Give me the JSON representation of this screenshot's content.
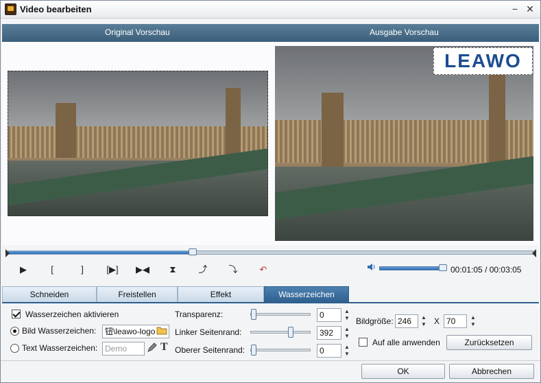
{
  "window": {
    "title": "Video bearbeiten",
    "minimize": "−",
    "close": "✕"
  },
  "preview": {
    "original_label": "Original Vorschau",
    "output_label": "Ausgabe Vorschau",
    "watermark_logo_text": "LEAWO"
  },
  "playback": {
    "progress_fraction": 0.35,
    "time_current": "00:01:05",
    "time_separator": "/",
    "time_total": "00:03:05",
    "volume_fraction": 1.0
  },
  "controls": {
    "play": "▶",
    "mark_in": "[",
    "mark_out": "]",
    "frame_step": "[▶]",
    "skip": "▶◀",
    "flip_vertical": "⧗",
    "rotate_right": "⤴",
    "rotate_left": "⤵",
    "undo": "↶"
  },
  "tabs": [
    {
      "label": "Schneiden",
      "active": false
    },
    {
      "label": "Freistellen",
      "active": false
    },
    {
      "label": "Effekt",
      "active": false
    },
    {
      "label": "Wasserzeichen",
      "active": true
    }
  ],
  "watermark": {
    "enable_label": "Wasserzeichen aktivieren",
    "enable_checked": true,
    "image_label": "Bild Wasserzeichen:",
    "image_selected": true,
    "image_path": "钮\\leawo-logo",
    "text_label": "Text Wasserzeichen:",
    "text_placeholder": "Demo",
    "transparency_label": "Transparenz:",
    "transparency_value": "0",
    "left_margin_label": "Linker Seitenrand:",
    "left_margin_value": "392",
    "top_margin_label": "Oberer Seitenrand:",
    "top_margin_value": "0",
    "size_label": "Bildgröße:",
    "width_value": "246",
    "size_x": "X",
    "height_value": "70",
    "apply_all_label": "Auf alle anwenden",
    "apply_all_checked": false,
    "reset_label": "Zurücksetzen"
  },
  "footer": {
    "ok_label": "OK",
    "cancel_label": "Abbrechen"
  },
  "icons": {
    "folder": "folder-icon",
    "pen": "pen-icon",
    "text": "text-icon",
    "speaker": "speaker-icon"
  }
}
